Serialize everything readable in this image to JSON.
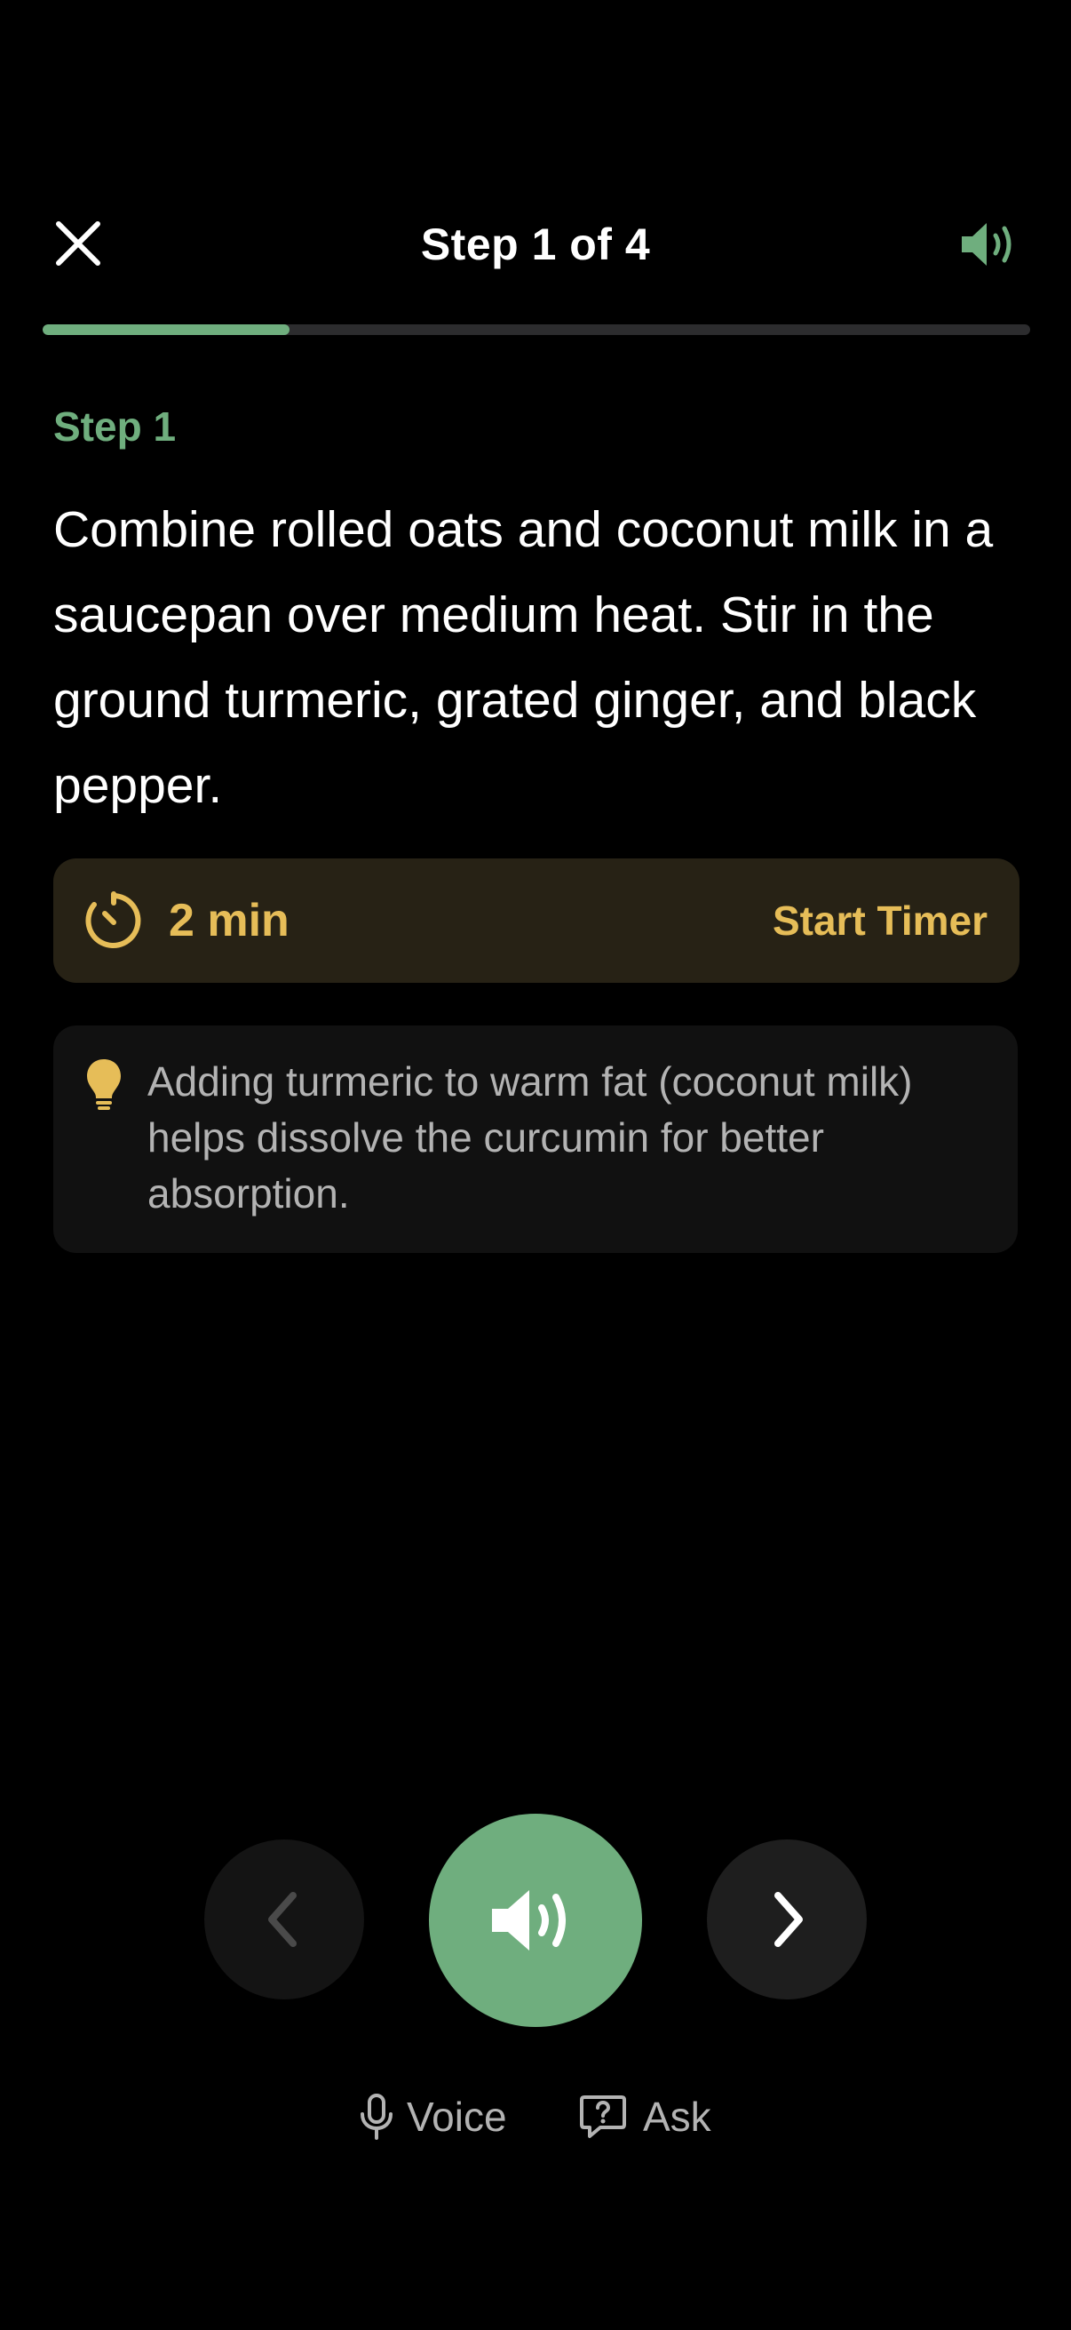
{
  "header": {
    "title": "Step 1 of 4",
    "close_icon": "close-icon",
    "speaker_icon": "speaker-icon",
    "accent_color": "#6fae7e"
  },
  "progress": {
    "current_step": 1,
    "total_steps": 4,
    "fraction": 0.25
  },
  "step": {
    "label": "Step 1",
    "instruction": "Combine rolled oats and coconut milk in a saucepan over medium heat. Stir in the ground turmeric, grated ginger, and black pepper."
  },
  "timer": {
    "icon": "timer-icon",
    "duration": "2 min",
    "action_label": "Start Timer",
    "color": "#e6bd58"
  },
  "tip": {
    "icon": "lightbulb-icon",
    "text": "Adding turmeric to warm fat (coconut milk) helps dissolve the curcumin for better absorption."
  },
  "controls": {
    "prev_icon": "chevron-left-icon",
    "play_icon": "speaker-icon",
    "next_icon": "chevron-right-icon",
    "voice_label": "Voice",
    "voice_icon": "microphone-icon",
    "ask_label": "Ask",
    "ask_icon": "question-bubble-icon"
  }
}
